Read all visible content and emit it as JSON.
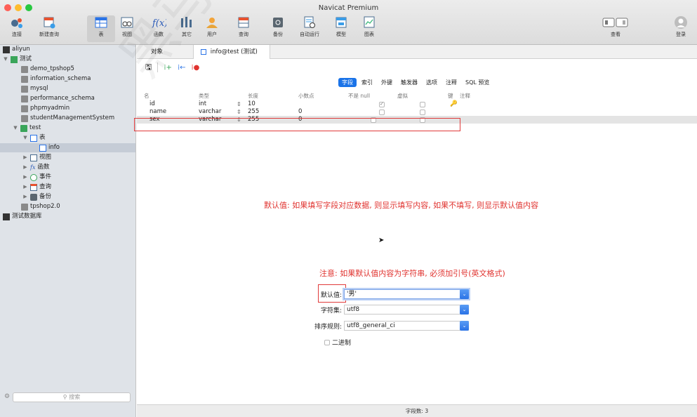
{
  "window": {
    "title": "Navicat Premium"
  },
  "toolbar": {
    "connect": "连接",
    "new_query": "新建查询",
    "table": "表",
    "view": "视图",
    "function": "函数",
    "other": "其它",
    "user": "用户",
    "query": "查询",
    "backup": "备份",
    "auto_run": "自动运行",
    "model": "模型",
    "chart": "图表",
    "view_mode": "查看",
    "login": "登录"
  },
  "sidebar": {
    "conn_aliyun": "aliyun",
    "conn_test": "测试",
    "db_items": [
      "demo_tpshop5",
      "information_schema",
      "mysql",
      "performance_schema",
      "phpmyadmin",
      "studentManagementSystem"
    ],
    "db_test": "test",
    "tables_group": "表",
    "table_info": "info",
    "views_group": "视图",
    "functions_group": "函数",
    "events_group": "事件",
    "queries_group": "查询",
    "backups_group": "备份",
    "db_tpshop": "tpshop2.0",
    "conn_testdb": "测试数据库",
    "search_placeholder": "搜索"
  },
  "tabs": {
    "objects": "对象",
    "editor": "info@test (测试)"
  },
  "subtabs": [
    "字段",
    "索引",
    "外键",
    "触发器",
    "选项",
    "注释",
    "SQL 预览"
  ],
  "grid": {
    "headers": {
      "name": "名",
      "type": "类型",
      "length": "长度",
      "decimals": "小数点",
      "not_null": "不是 null",
      "virtual": "虚拟",
      "key": "键",
      "comment": "注释"
    },
    "rows": [
      {
        "name": "id",
        "type": "int",
        "length": "10",
        "decimals": ""
      },
      {
        "name": "name",
        "type": "varchar",
        "length": "255",
        "decimals": "0"
      },
      {
        "name": "sex",
        "type": "varchar",
        "length": "255",
        "decimals": "0"
      }
    ]
  },
  "annotations": {
    "note1": "默认值: 如果填写字段对应数据, 则显示填写内容, 如果不填写, 则显示默认值内容",
    "note2": "注意: 如果默认值内容为字符串, 必须加引号(英文格式)"
  },
  "properties": {
    "default_label": "默认值:",
    "default_value": "'男'",
    "charset_label": "字符集:",
    "charset_value": "utf8",
    "collation_label": "排序规则:",
    "collation_value": "utf8_general_ci",
    "binary_label": "二进制"
  },
  "status": {
    "field_count": "字段数: 3"
  },
  "watermark": "黑马程序员 http",
  "colors": {
    "accent": "#1a73e8",
    "annotation_red": "#e0332f",
    "sidebar_bg": "#dfe3e8"
  }
}
